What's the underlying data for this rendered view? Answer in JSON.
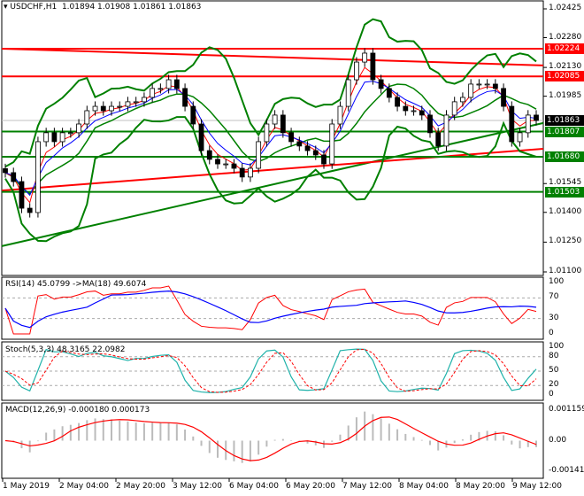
{
  "header": {
    "symbol": "USDCHF,H1",
    "ohlc": "1.01894 1.01908 1.01861 1.01863"
  },
  "colors": {
    "bull": "#ffffff",
    "bear": "#000000",
    "band": "#008000",
    "red": "#ff0000",
    "green": "#008000",
    "blue": "#0000ff",
    "teal": "#20b2aa",
    "grey": "#bbbbbb"
  },
  "chart_data": [
    {
      "type": "candlestick",
      "title": "USDCHF,H1",
      "ylim": [
        1.011,
        1.02425
      ],
      "closes": [
        1.016,
        1.01555,
        1.01421,
        1.01399,
        1.01756,
        1.01801,
        1.01756,
        1.01801,
        1.01801,
        1.01845,
        1.01912,
        1.01934,
        1.01912,
        1.01934,
        1.01934,
        1.01957,
        1.01957,
        1.01979,
        1.02024,
        1.02024,
        1.02068,
        1.02024,
        1.01934,
        1.01845,
        1.01711,
        1.01667,
        1.01644,
        1.01644,
        1.01622,
        1.01578,
        1.01622,
        1.01756,
        1.01845,
        1.0189,
        1.01801,
        1.01756,
        1.01734,
        1.01711,
        1.01689,
        1.01644,
        1.01845,
        1.01934,
        1.02068,
        1.02157,
        1.02202,
        1.02068,
        1.02024,
        1.01979,
        1.01934,
        1.01912,
        1.01912,
        1.0189,
        1.01801,
        1.01734,
        1.0189,
        1.01957,
        1.01979,
        1.02046,
        1.02046,
        1.02046,
        1.02024,
        1.01934,
        1.01756,
        1.01801,
        1.0189,
        1.01863
      ],
      "y_ticks": [
        "1.02425",
        "1.02280",
        "1.02130",
        "1.01985",
        "1.01545",
        "1.01400",
        "1.01250",
        "1.01100"
      ],
      "levels": [
        {
          "value": "1.02224",
          "color": "#ff0000"
        },
        {
          "value": "1.02085",
          "color": "#ff0000"
        },
        {
          "value": "1.01863",
          "color": "#000000",
          "current": true
        },
        {
          "value": "1.01807",
          "color": "#008000"
        },
        {
          "value": "1.01680",
          "color": "#008000"
        },
        {
          "value": "1.01503",
          "color": "#008000"
        }
      ],
      "trendlines": [
        {
          "color": "#ff0000",
          "from": 1.02224,
          "to": 1.0214
        },
        {
          "color": "#008000",
          "from": 1.0123,
          "to": 1.0185
        },
        {
          "color": "#ff0000",
          "from": 1.0151,
          "to": 1.0172
        }
      ],
      "x_labels": [
        "1 May 2019",
        "2 May 04:00",
        "2 May 20:00",
        "3 May 12:00",
        "6 May 04:00",
        "6 May 20:00",
        "7 May 12:00",
        "8 May 04:00",
        "8 May 20:00",
        "9 May 12:00"
      ]
    },
    {
      "type": "line",
      "title": "RSI(14) 45.0799  ->MA(18) 49.6074",
      "ylim": [
        0,
        100
      ],
      "y_ticks": [
        "100",
        "70",
        "30",
        "0"
      ],
      "levels": [
        70,
        30
      ]
    },
    {
      "type": "line",
      "title": "Stoch(5,3,3) 48.3165 22.0982",
      "ylim": [
        0,
        100
      ],
      "y_ticks": [
        "100",
        "80",
        "50",
        "20",
        "0"
      ],
      "levels": [
        80,
        50,
        20
      ]
    },
    {
      "type": "bar",
      "title": "MACD(12,26,9) -0.000180 0.000173",
      "ylim": [
        -0.001412,
        0.001159
      ],
      "y_ticks": [
        "0.001159",
        "0.00",
        "-0.001412"
      ]
    }
  ]
}
